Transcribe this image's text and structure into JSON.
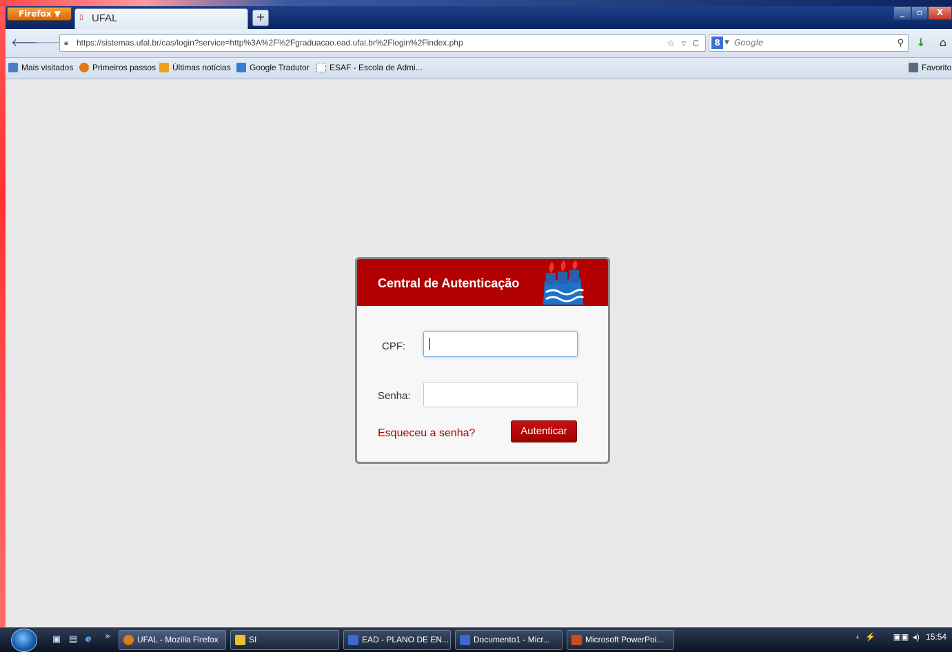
{
  "browser": {
    "menu_button": "Firefox ▼",
    "tab_title": "UFAL",
    "new_tab": "+",
    "window_controls": {
      "minimize": "_",
      "maximize": "▫",
      "close": "X"
    },
    "url": "https://sistemas.ufal.br/cas/login?service=http%3A%2F%2Fgraduacao.ead.ufal.br%2Flogin%2Findex.php",
    "url_tools": "☆ ▿ C",
    "search_engine_icon": "8",
    "search_placeholder": "Google"
  },
  "bookmarks": {
    "items": [
      {
        "label": "Mais visitados",
        "icon": "page-icon",
        "color": "#4d7fc4"
      },
      {
        "label": "Primeiros passos",
        "icon": "firefox-icon",
        "color": "#e07b16"
      },
      {
        "label": "Últimas notícias",
        "icon": "rss-icon",
        "color": "#f0a020"
      },
      {
        "label": "Google Tradutor",
        "icon": "translate-icon",
        "color": "#3a7ad8"
      },
      {
        "label": "ESAF - Escola de Admi...",
        "icon": "dotted-page-icon",
        "color": "#ffffff"
      }
    ],
    "favorites_label": "Favorito"
  },
  "login": {
    "title": "Central de Autenticação",
    "cpf_label": "CPF:",
    "cpf_value": "",
    "senha_label": "Senha:",
    "senha_value": "",
    "forgot_link": "Esqueceu a senha?",
    "submit_label": "Autenticar",
    "accent_color": "#b30000"
  },
  "taskbar": {
    "overflow": "»",
    "items": [
      {
        "label": "UFAL - Mozilla Firefox",
        "icon_color": "#e07b16",
        "active": true
      },
      {
        "label": "SI",
        "icon_color": "#e8c030",
        "active": false
      },
      {
        "label": "EAD - PLANO DE EN...",
        "icon_color": "#3a6ad0",
        "active": false
      },
      {
        "label": "Documento1 - Micr...",
        "icon_color": "#3a6ad0",
        "active": false
      },
      {
        "label": "Microsoft PowerPoi...",
        "icon_color": "#d04a20",
        "active": false
      }
    ],
    "clock": "15:54"
  }
}
